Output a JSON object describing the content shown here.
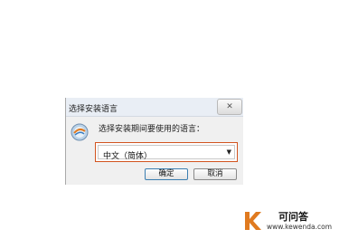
{
  "dialog": {
    "title": "选择安装语言",
    "close_label": "✕",
    "prompt": "选择安装期间要使用的语言：",
    "language_select": {
      "value": "中文（简体）",
      "arrow": "▼"
    },
    "ok_label": "确定",
    "cancel_label": "取消",
    "icons": {
      "setup": "setup-globe-icon"
    }
  },
  "watermark": {
    "name": "可问答",
    "url": "www.kewenda.com",
    "logo_letter": "K"
  },
  "colors": {
    "focus_border": "#d2541f",
    "logo": "#e07a1f",
    "dialog_bg": "#f0f0f0"
  }
}
